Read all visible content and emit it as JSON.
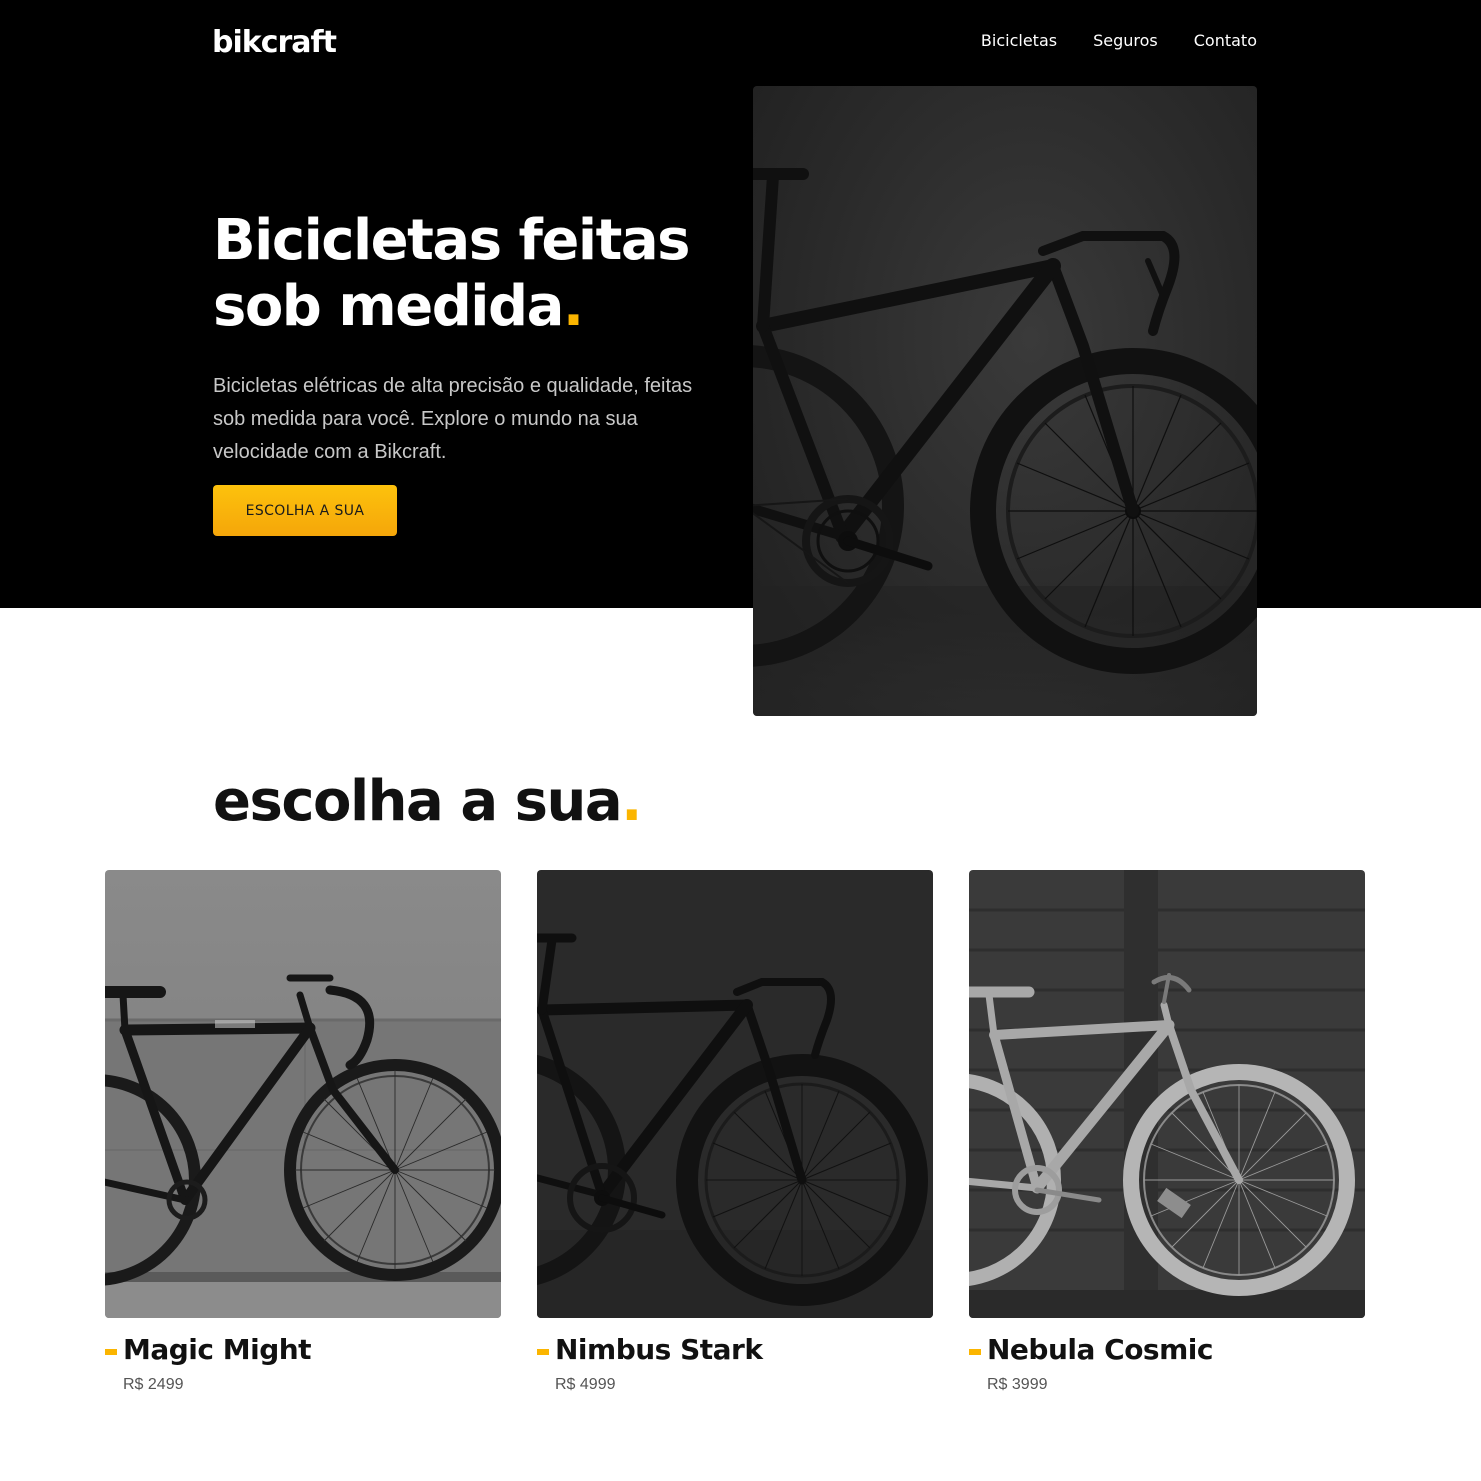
{
  "header": {
    "logo": "bikcraft",
    "nav": [
      {
        "label": "Bicicletas"
      },
      {
        "label": "Seguros"
      },
      {
        "label": "Contato"
      }
    ]
  },
  "hero": {
    "title_line1": "Bicicletas feitas",
    "title_line2": "sob medida",
    "title_dot": ".",
    "description": "Bicicletas elétricas de alta precisão e qualidade, feitas sob medida para você. Explore o mundo na sua velocidade com a Bikcraft.",
    "cta_label": "ESCOLHA A SUA"
  },
  "section": {
    "title": "escolha a sua",
    "title_dot": "."
  },
  "products": [
    {
      "name": "Magic Might",
      "price": "R$ 2499"
    },
    {
      "name": "Nimbus Stark",
      "price": "R$ 4999"
    },
    {
      "name": "Nebula Cosmic",
      "price": "R$ 3999"
    }
  ],
  "colors": {
    "accent": "#fbb500",
    "hero_background": "#000000",
    "page_background": "#ffffff",
    "text_dark": "#111111",
    "text_muted": "#c8c8c8"
  }
}
